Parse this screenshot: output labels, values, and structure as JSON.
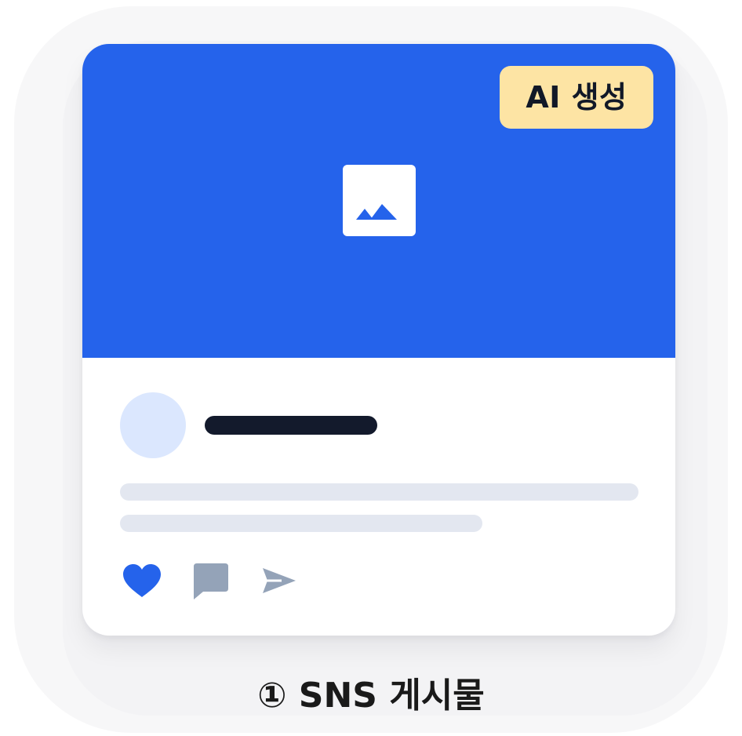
{
  "badge": {
    "label": "AI 생성",
    "background_color": "#fde4a4"
  },
  "post_card": {
    "media_color": "#2563eb",
    "icons": {
      "image": "image-icon",
      "like": "heart-icon",
      "comment": "comment-icon",
      "share": "send-icon"
    },
    "like_color": "#2563eb",
    "muted_icon_color": "#94a3b8"
  },
  "caption": {
    "label": "① SNS 게시물"
  }
}
